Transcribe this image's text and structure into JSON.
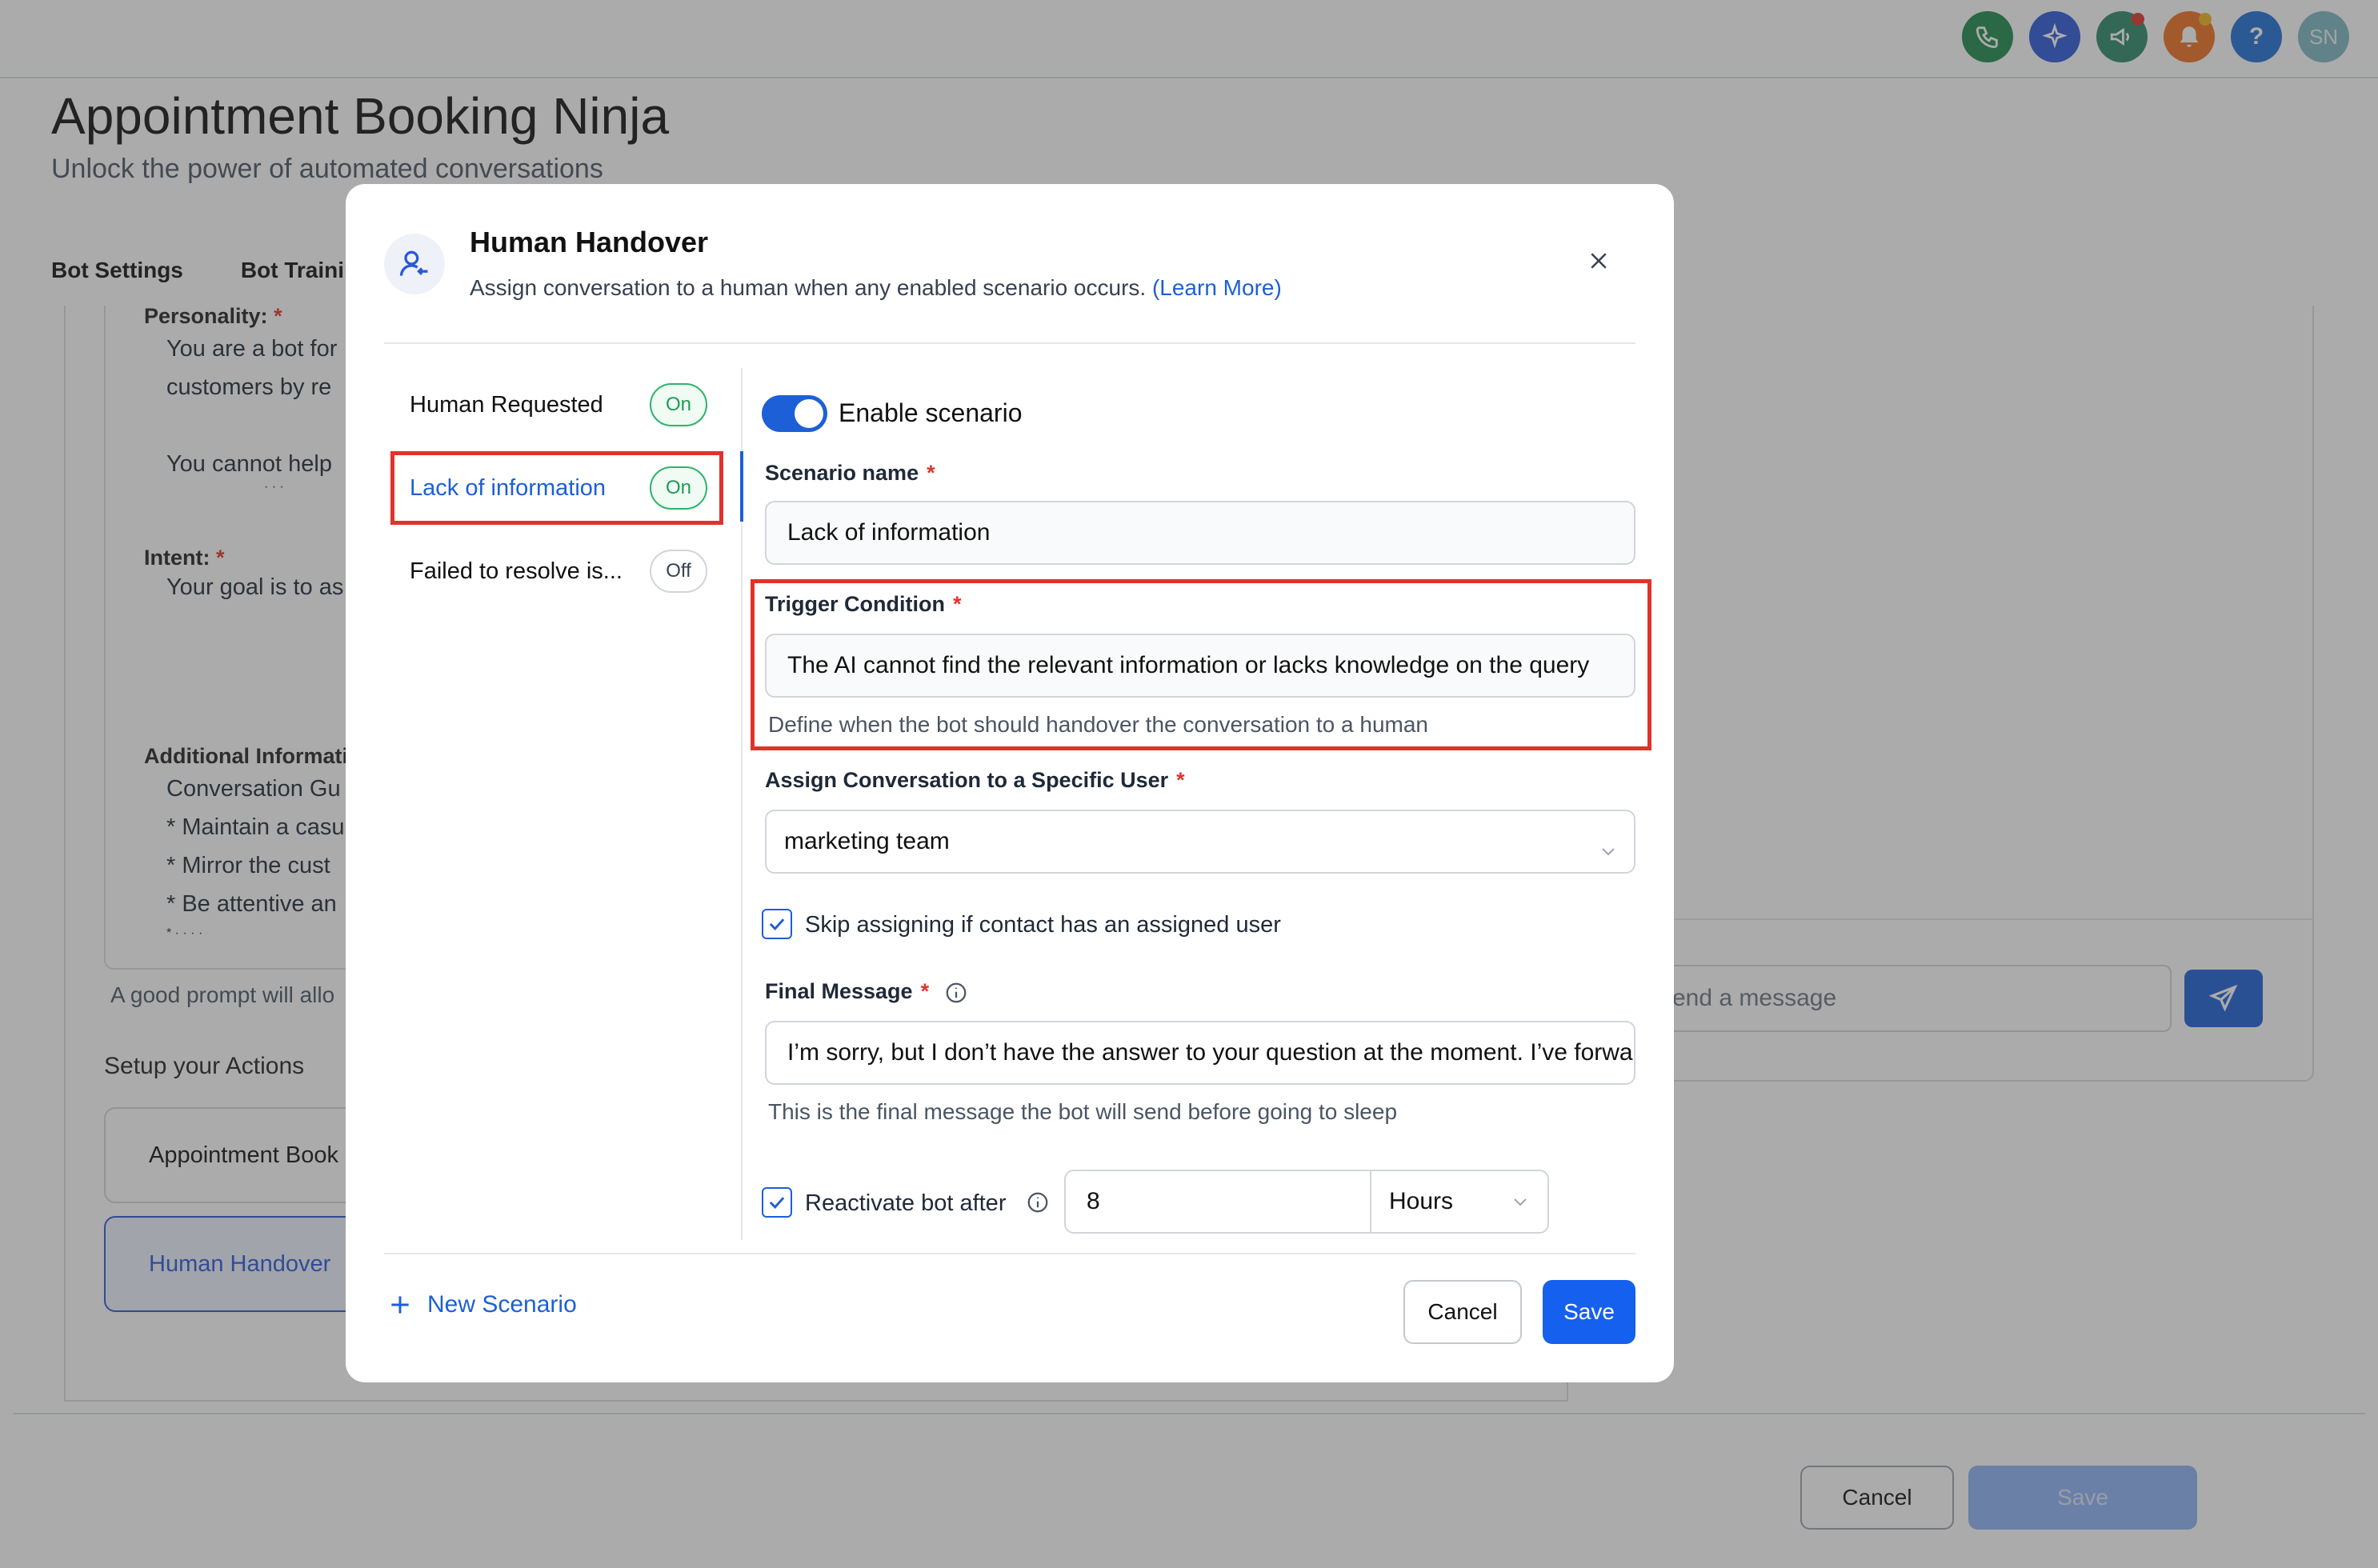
{
  "app": {
    "title": "Appointment Booking Ninja",
    "subtitle": "Unlock the power of automated conversations",
    "avatar_initials": "SN",
    "help_label": "?",
    "header_icons": [
      {
        "name": "phone-icon",
        "color": "#1f8a4c"
      },
      {
        "name": "ai-sparkle-icon",
        "color": "#2b59d9"
      },
      {
        "name": "megaphone-icon",
        "color": "#2e8a6a"
      },
      {
        "name": "bell-icon",
        "color": "#f07021"
      },
      {
        "name": "help-icon",
        "color": "#1f6fd6"
      },
      {
        "name": "avatar",
        "color": "#7fb7c4"
      }
    ]
  },
  "background": {
    "tabs": [
      "Bot Settings",
      "Bot Trainin"
    ],
    "personality_label": "Personality:",
    "personality_lines": [
      "You are a bot for",
      "customers by re",
      "You cannot help",
      "· · ·"
    ],
    "intent_label": "Intent:",
    "intent_text": "Your goal is to as",
    "additional_label": "Additional Informati",
    "additional_lines": [
      "Conversation Gu",
      "* Maintain a casu",
      "* Mirror the cust",
      "* Be attentive an",
      "* · · · ·"
    ],
    "hint": "A good prompt will allo",
    "actions_label": "Setup your Actions",
    "action_cards": [
      "Appointment Book",
      "Human Handover"
    ],
    "chat_input_placeholder": "end a message",
    "cancel_label": "Cancel",
    "save_label": "Save"
  },
  "modal": {
    "title": "Human Handover",
    "description": "Assign conversation to a human when any enabled scenario occurs.",
    "learn_more": "(Learn More)",
    "scenarios": [
      {
        "label": "Human Requested",
        "status": "On"
      },
      {
        "label": "Lack of information",
        "status": "On"
      },
      {
        "label": "Failed to resolve is...",
        "status": "Off"
      }
    ],
    "enable_scenario_label": "Enable scenario",
    "enable_scenario_on": true,
    "scenario_name_label": "Scenario name",
    "scenario_name_value": "Lack of information",
    "trigger_label": "Trigger Condition",
    "trigger_value": "The AI cannot find the relevant information or lacks knowledge on the query",
    "trigger_help": "Define when the bot should handover the conversation to a human",
    "assign_label": "Assign Conversation to a Specific User",
    "assign_value": "marketing team",
    "skip_label": "Skip assigning if contact has an assigned user",
    "skip_checked": true,
    "final_message_label": "Final Message",
    "final_message_value": "I’m sorry, but I don’t have the answer to your question at the moment. I’ve forwarded your query to our team",
    "final_message_help": "This is the final message the bot will send before going to sleep",
    "reactivate_label": "Reactivate bot after",
    "reactivate_checked": true,
    "reactivate_value": "8",
    "reactivate_unit": "Hours",
    "new_scenario_label": "New Scenario",
    "cancel_label": "Cancel",
    "save_label": "Save",
    "required_mark": "*"
  },
  "colors": {
    "primary": "#1560ee",
    "highlight": "#e0332b",
    "on_green": "#2fb36a"
  }
}
